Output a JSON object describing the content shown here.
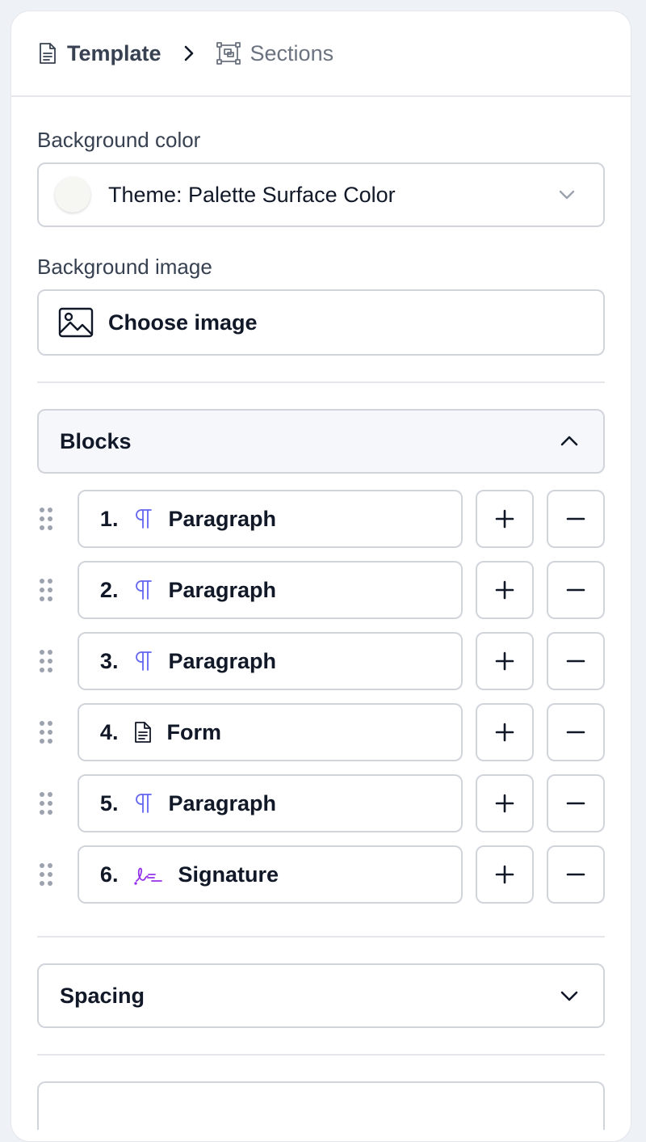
{
  "breadcrumb": {
    "template_label": "Template",
    "sections_label": "Sections"
  },
  "background_color": {
    "label": "Background color",
    "value": "Theme: Palette Surface Color",
    "swatch": "#f6f6f2"
  },
  "background_image": {
    "label": "Background image",
    "button_label": "Choose image"
  },
  "blocks": {
    "title": "Blocks",
    "expanded": true,
    "items": [
      {
        "num": "1.",
        "icon": "paragraph-icon",
        "label": "Paragraph"
      },
      {
        "num": "2.",
        "icon": "paragraph-icon",
        "label": "Paragraph"
      },
      {
        "num": "3.",
        "icon": "paragraph-icon",
        "label": "Paragraph"
      },
      {
        "num": "4.",
        "icon": "document-icon",
        "label": "Form"
      },
      {
        "num": "5.",
        "icon": "paragraph-icon",
        "label": "Paragraph"
      },
      {
        "num": "6.",
        "icon": "signature-icon",
        "label": "Signature"
      }
    ]
  },
  "spacing": {
    "title": "Spacing",
    "expanded": false
  },
  "colors": {
    "accent": "#6366f1",
    "signature": "#9333ea"
  }
}
